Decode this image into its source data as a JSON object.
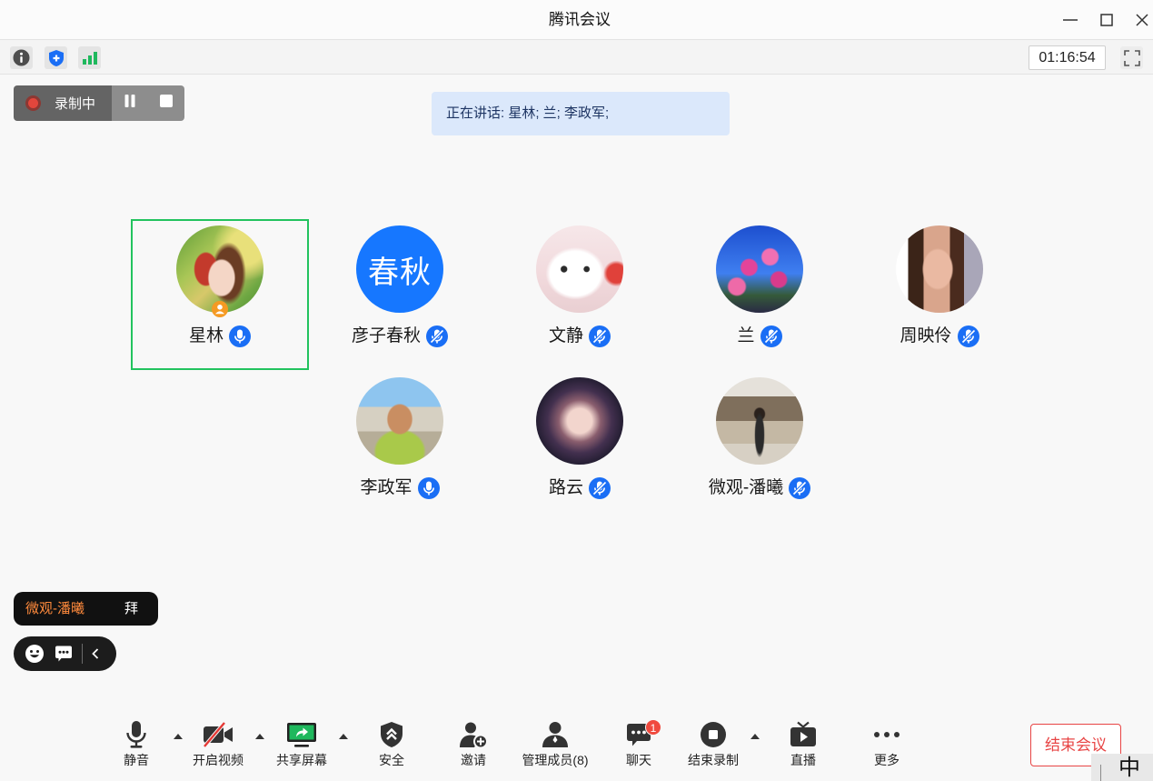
{
  "window": {
    "title": "腾讯会议",
    "controls": [
      "minimize-icon",
      "maximize-icon",
      "close-icon"
    ]
  },
  "status_bar": {
    "icons": [
      "info-icon",
      "security-shield-icon",
      "network-signal-icon"
    ],
    "timer": "01:16:54",
    "fullscreen_icon": "fullscreen-icon"
  },
  "recording": {
    "label": "录制中",
    "icons": [
      "recording-dot-icon",
      "pause-icon",
      "stop-icon"
    ]
  },
  "speaking_banner": {
    "text": "正在讲话: 星林; 兰; 李政军;"
  },
  "participants": [
    {
      "name": "星林",
      "mic_icon": "mic-on-icon",
      "badge_icon": "host-icon",
      "selected": true
    },
    {
      "name": "彦子春秋",
      "avatar_text": "春秋",
      "mic_icon": "mic-muted-icon"
    },
    {
      "name": "文静",
      "mic_icon": "mic-muted-icon"
    },
    {
      "name": "兰",
      "mic_icon": "mic-muted-icon"
    },
    {
      "name": "周映伶",
      "mic_icon": "mic-muted-icon"
    },
    {
      "name": "李政军",
      "mic_icon": "mic-on-icon"
    },
    {
      "name": "路云",
      "mic_icon": "mic-muted-icon"
    },
    {
      "name": "微观-潘曦",
      "mic_icon": "mic-muted-icon"
    }
  ],
  "chat_popup": {
    "sender": "微观-潘曦",
    "message": "拜"
  },
  "chat_quickbar": {
    "icons": [
      "emoji-icon",
      "chat-input-icon",
      "chevron-left-icon"
    ]
  },
  "toolbar": {
    "items": [
      {
        "label": "静音",
        "icon": "mic-icon",
        "menu_icon": "caret-up-icon"
      },
      {
        "label": "开启视频",
        "icon": "video-off-icon",
        "menu_icon": "caret-up-icon"
      },
      {
        "label": "共享屏幕",
        "icon": "share-screen-icon",
        "menu_icon": "caret-up-icon"
      },
      {
        "label": "安全",
        "icon": "security-icon"
      },
      {
        "label": "邀请",
        "icon": "invite-user-icon"
      },
      {
        "label": "管理成员(8)",
        "icon": "members-icon"
      },
      {
        "label": "聊天",
        "icon": "chat-icon",
        "badge": "1"
      },
      {
        "label": "结束录制",
        "icon": "stop-recording-icon",
        "menu_icon": "caret-up-icon"
      },
      {
        "label": "直播",
        "icon": "live-stream-icon"
      },
      {
        "label": "更多",
        "icon": "more-icon"
      }
    ],
    "end_meeting_label": "结束会议"
  },
  "ime_indicator": {
    "label": "中"
  },
  "colors": {
    "accent_blue": "#1a6ef5",
    "avatar_blue": "#1677ff",
    "selected_border": "#22c35e",
    "recording_red": "#e2463c",
    "speaking_banner_bg": "#dbe8fb",
    "chat_sender_orange": "#ff8a3c",
    "share_green": "#1fb85d",
    "danger_red": "#e84545",
    "badge_red": "#f04a3e"
  }
}
